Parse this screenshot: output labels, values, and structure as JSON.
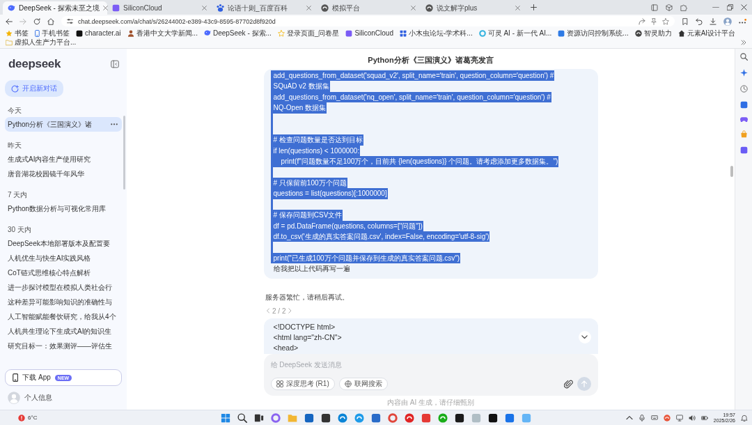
{
  "browser": {
    "tabs": [
      {
        "title": "DeepSeek - 探索未至之境",
        "selected": true
      },
      {
        "title": "SiliconCloud",
        "selected": false
      },
      {
        "title": "论语十则_百度百科",
        "selected": false
      },
      {
        "title": "模拟平台",
        "selected": false
      },
      {
        "title": "说文解字plus",
        "selected": false
      }
    ],
    "address": "chat.deepseek.com/a/chat/s/26244002-e389-43c9-8595-87702d8f920d",
    "bookmarks": [
      "书签",
      "手机书签",
      "character.ai",
      "香港中文大学新闻...",
      "DeepSeek - 探索...",
      "登录页面_问卷星",
      "SiliconCloud",
      "小木虫论坛-学术科...",
      "可灵 AI - 新一代 AI...",
      "资源访问控制系统...",
      "智灵助力",
      "元素AI设计平台",
      "虚拟人生产力平台..."
    ]
  },
  "sidebar": {
    "logo": "deepseek",
    "new_chat": "开启新对话",
    "groups": [
      {
        "label": "今天",
        "items": [
          {
            "title": "Python分析《三国演义》诸",
            "selected": true
          }
        ]
      },
      {
        "label": "昨天",
        "items": [
          {
            "title": "生成式AI内容生产使用研究",
            "selected": false
          },
          {
            "title": "唐音湖花校园镜千年风华",
            "selected": false
          }
        ]
      },
      {
        "label": "7 天内",
        "items": [
          {
            "title": "Python数据分析与可视化常用库",
            "selected": false
          }
        ]
      },
      {
        "label": "30 天内",
        "items": [
          {
            "title": "DeepSeek本地部署版本及配置要",
            "selected": false
          },
          {
            "title": "人机优生与快生AI实践风格",
            "selected": false
          },
          {
            "title": "CoT链式思维核心特点解析",
            "selected": false
          },
          {
            "title": "进一步探讨模型在模拟人类社会行",
            "selected": false
          },
          {
            "title": "这种差异可能影响知识的准确性与",
            "selected": false
          },
          {
            "title": "人工智能赋能餐饮研究，给我从4个",
            "selected": false
          },
          {
            "title": "人机共生理论下生成式AI的知识生",
            "selected": false
          },
          {
            "title": "研究目标一：效果测评——评估生",
            "selected": false
          }
        ]
      }
    ],
    "download": {
      "label": "下载 App",
      "badge": "NEW"
    },
    "profile": "个人信息"
  },
  "chat": {
    "title": "Python分析《三国演义》诸葛亮发言",
    "user_lines": [
      {
        "kind": "text",
        "text": "add_questions_from_dataset('squad_v2', split_name='train', question_column='question') #",
        "selected": true
      },
      {
        "kind": "text",
        "text": "SQuAD v2 数据集",
        "selected": true
      },
      {
        "kind": "text",
        "text": "add_questions_from_dataset('nq_open', split_name='train', question_column='question') #",
        "selected": true
      },
      {
        "kind": "text",
        "text": "NQ-Open 数据集",
        "selected": true
      },
      {
        "kind": "blank",
        "selected": true
      },
      {
        "kind": "blank",
        "selected": true
      },
      {
        "kind": "text",
        "text": "# 检查问题数量是否达到目标",
        "selected": true
      },
      {
        "kind": "text",
        "text": "if len(questions) < 1000000:",
        "selected": true
      },
      {
        "kind": "text",
        "text": "    print(f\"问题数量不足100万个，目前共 {len(questions)} 个问题。请考虑添加更多数据集。\")",
        "selected": true
      },
      {
        "kind": "blank",
        "selected": true
      },
      {
        "kind": "text",
        "text": "# 只保留前100万个问题",
        "selected": true
      },
      {
        "kind": "text",
        "text": "questions = list(questions)[:1000000]",
        "selected": true
      },
      {
        "kind": "blank",
        "selected": true
      },
      {
        "kind": "text",
        "text": "# 保存问题到CSV文件",
        "selected": true
      },
      {
        "kind": "text",
        "text": "df = pd.DataFrame(questions, columns=[\"问题\"])",
        "selected": true
      },
      {
        "kind": "text",
        "text": "df.to_csv('生成的真实答案问题.csv', index=False, encoding='utf-8-sig')",
        "selected": true
      },
      {
        "kind": "blank",
        "selected": true
      },
      {
        "kind": "text",
        "text": "print(\"已生成100万个问题并保存到生成的真实答案问题.csv\")",
        "selected": true
      },
      {
        "kind": "text",
        "text": "给我把以上代码再写一遍",
        "selected": false
      }
    ],
    "reply": {
      "text": "服务器繁忙，请稍后再试。",
      "pager": "2 / 2"
    },
    "next_message_lines": [
      "<!DOCTYPE html>",
      "<html lang=\"zh-CN\">",
      "<head>"
    ],
    "composer": {
      "placeholder": "给 DeepSeek 发送消息",
      "toggles": [
        {
          "label": "深度思考 (R1)",
          "on": false
        },
        {
          "label": "联网搜索",
          "on": false
        }
      ],
      "send_disabled": true
    },
    "disclaimer": "内容由 AI 生成，请仔细甄别"
  },
  "taskbar": {
    "weather": "6°C",
    "time": "19:57",
    "date": "2025/2/26"
  }
}
